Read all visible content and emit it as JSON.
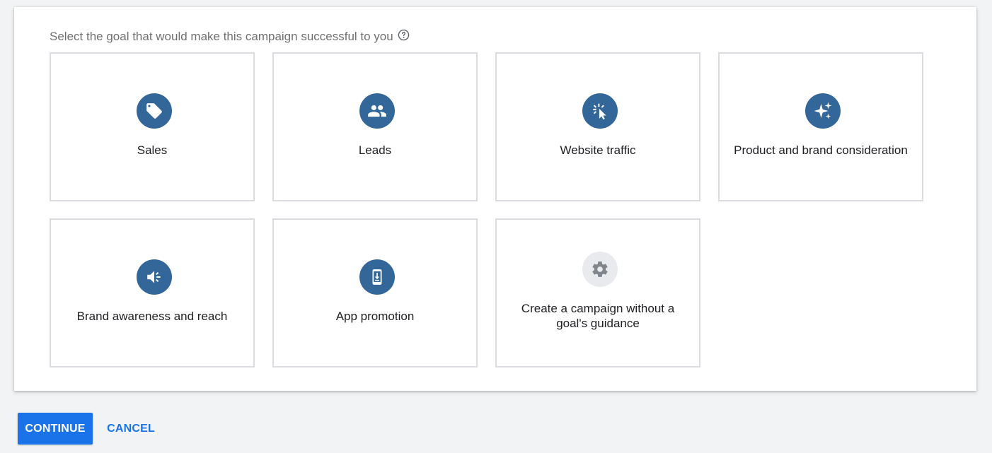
{
  "goal_selection": {
    "prompt": "Select the goal that would make this campaign successful to you",
    "goals": [
      {
        "label": "Sales",
        "icon": "tag-icon"
      },
      {
        "label": "Leads",
        "icon": "people-icon"
      },
      {
        "label": "Website traffic",
        "icon": "cursor-click-icon"
      },
      {
        "label": "Product and brand consideration",
        "icon": "sparkle-icon"
      },
      {
        "label": "Brand awareness and reach",
        "icon": "speaker-icon"
      },
      {
        "label": "App promotion",
        "icon": "phone-download-icon"
      },
      {
        "label": "Create a campaign without a goal's guidance",
        "icon": "gear-icon"
      }
    ]
  },
  "actions": {
    "continue_label": "CONTINUE",
    "cancel_label": "CANCEL"
  },
  "colors": {
    "icon_circle": "#336699",
    "accent": "#1a73e8",
    "neutral_circle": "#e8eaed"
  }
}
